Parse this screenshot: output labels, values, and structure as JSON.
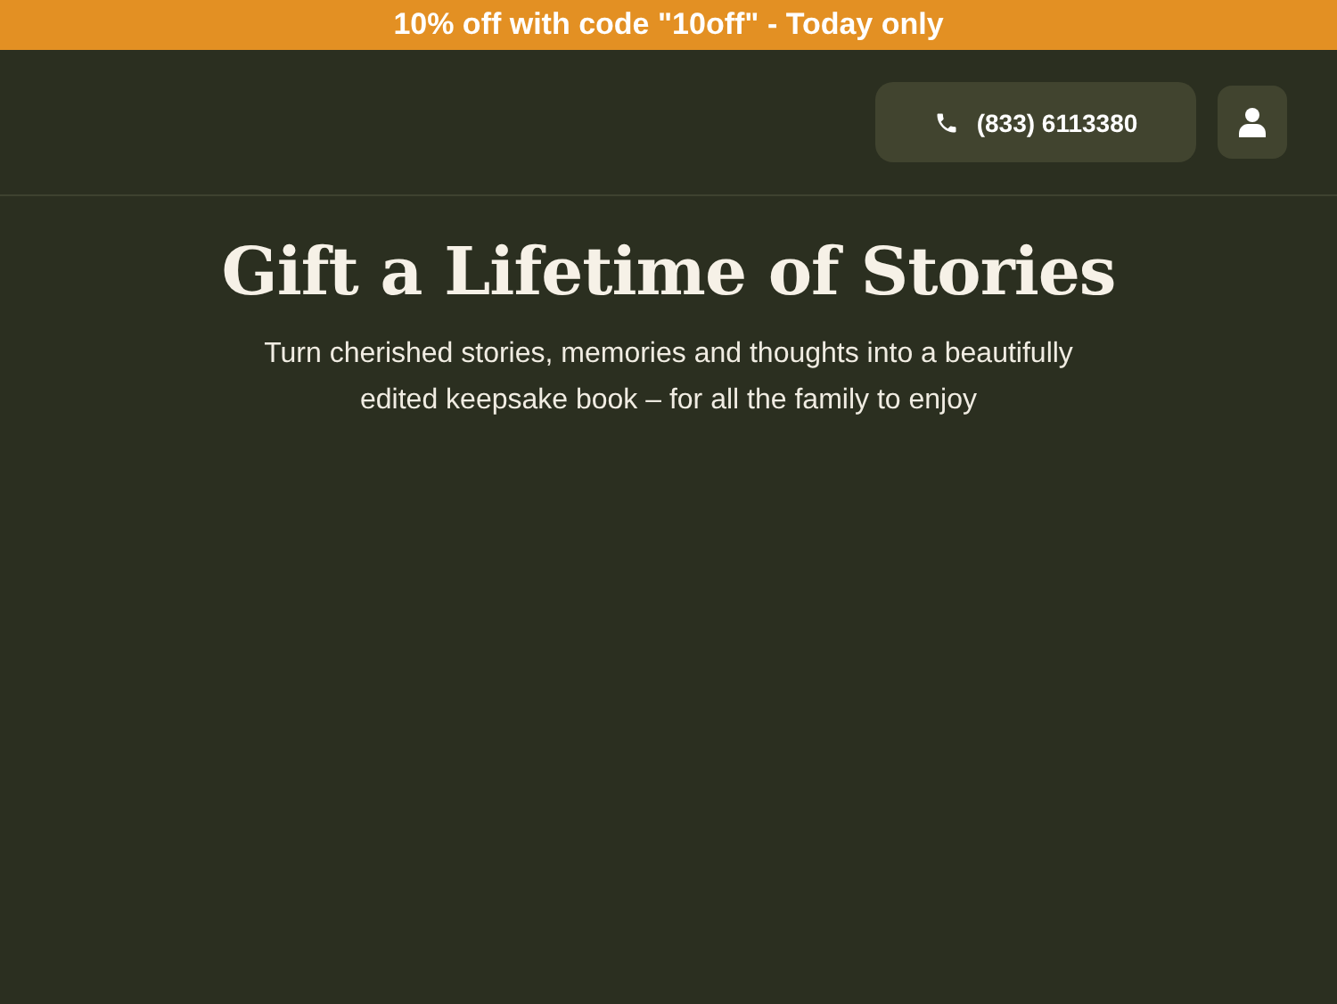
{
  "banner": {
    "text": "10% off with code \"10off\" - Today only"
  },
  "header": {
    "phone": "(833) 6113380"
  },
  "hero": {
    "title": "Gift a Lifetime of Stories",
    "subtitle": "Turn cherished stories, memories and thoughts into a beautifully edited keepsake book – for all the family to enjoy"
  }
}
